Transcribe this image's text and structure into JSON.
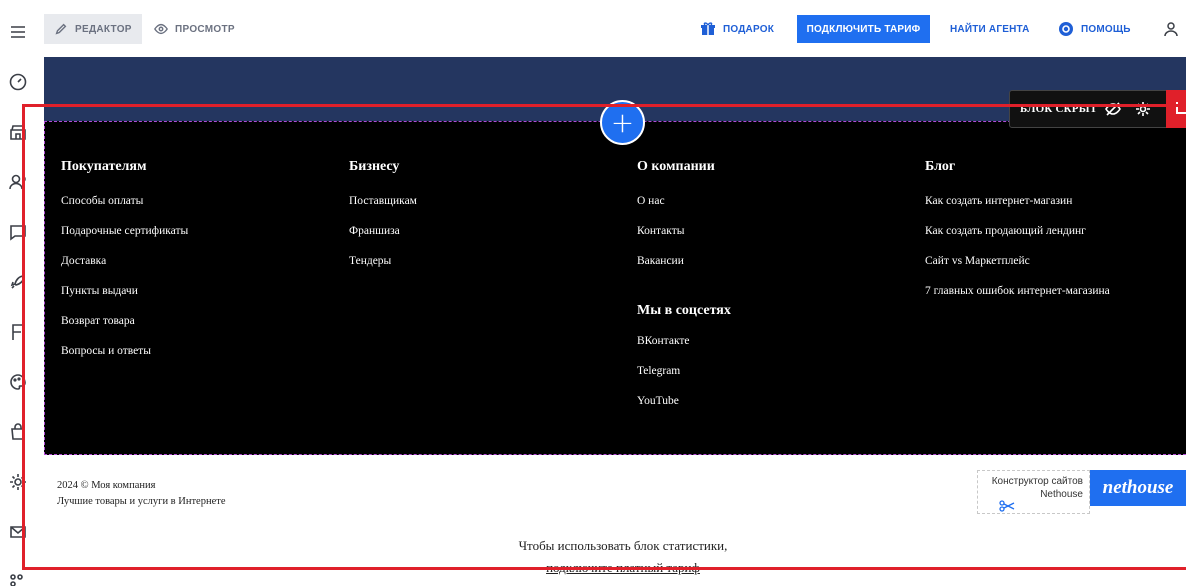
{
  "topbar": {
    "editor_label": "РЕДАКТОР",
    "preview_label": "ПРОСМОТР",
    "gift_label": "ПОДАРОК",
    "tariff_label": "ПОДКЛЮЧИТЬ ТАРИФ",
    "agent_label": "НАЙТИ АГЕНТА",
    "help_label": "ПОМОЩЬ",
    "accent_color": "#1f6ff0"
  },
  "sidebar": {
    "icons": [
      "menu-icon",
      "dashboard-icon",
      "store-icon",
      "users-icon",
      "chat-icon",
      "rocket-icon",
      "flag-icon",
      "palette-icon",
      "bag-icon",
      "settings-icon",
      "mail-icon",
      "apps-icon"
    ]
  },
  "block": {
    "hidden_label": "БЛОК СКРЫТ",
    "add_symbol": "+",
    "selection_color": "#e0202a"
  },
  "footer": {
    "columns": [
      {
        "title": "Покупателям",
        "links": [
          "Способы оплаты",
          "Подарочные сертификаты",
          "Доставка",
          "Пункты выдачи",
          "Возврат товара",
          "Вопросы и ответы"
        ]
      },
      {
        "title": "Бизнесу",
        "links": [
          "Поставщикам",
          "Франшиза",
          "Тендеры"
        ]
      },
      {
        "title": "О компании",
        "links": [
          "О нас",
          "Контакты",
          "Вакансии"
        ]
      },
      {
        "title": "Блог",
        "links": [
          "Как создать интернет-магазин",
          "Как создать продающий лендинг",
          "Сайт vs Маркетплейс",
          "7 главных ошибок интернет-магазина"
        ]
      }
    ],
    "social": {
      "title": "Мы в соцсетях",
      "links": [
        "ВКонтакте",
        "Telegram",
        "YouTube"
      ]
    }
  },
  "copyright": {
    "line1": "2024 © Моя компания",
    "line2": "Лучшие товары и услуги в Интернете"
  },
  "badge": {
    "line1": "Конструктор сайтов",
    "line2": "Nethouse",
    "logo": "nethouse"
  },
  "stats": {
    "line1": "Чтобы использовать блок статистики,",
    "line2": "подключите платный тариф"
  }
}
